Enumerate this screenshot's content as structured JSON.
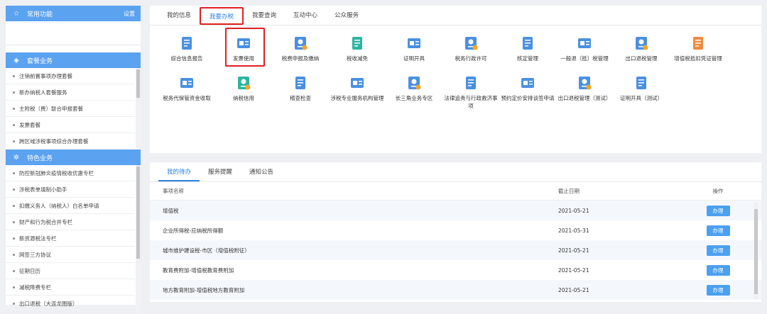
{
  "sidebar": {
    "common": {
      "title": "常用功能",
      "setting": "设置"
    },
    "package": {
      "title": "套餐业务",
      "items": [
        "注销前置事项办理套餐",
        "新办纳税人套餐服务",
        "主附税（费）联合申报套餐",
        "发票套餐",
        "跨区域涉税事项综合办理套餐"
      ]
    },
    "special": {
      "title": "特色业务",
      "items": [
        "防控新冠肺炎疫情税收优惠专栏",
        "涉税表单填制小助手",
        "扣缴义务人（纳税人）白名单申请",
        "财产和行为税合并专栏",
        "新资源税法专栏",
        "网签三方协议",
        "征期日历",
        "减税降费专栏",
        "出口退税（大连龙图版）"
      ]
    }
  },
  "top_tabs": [
    "我的信息",
    "我要办税",
    "我要查询",
    "互动中心",
    "公众服务"
  ],
  "services": [
    {
      "label": "综合信息报告",
      "icon": "report-icon",
      "color": "#4a90e2"
    },
    {
      "label": "发票使用",
      "icon": "invoice-icon",
      "color": "#4a90e2"
    },
    {
      "label": "税费申报及缴纳",
      "icon": "tax-declare-icon",
      "color": "#4a90e2"
    },
    {
      "label": "税收减免",
      "icon": "tax-relief-icon",
      "color": "#2cb5a0"
    },
    {
      "label": "证明开具",
      "icon": "certificate-icon",
      "color": "#4a90e2"
    },
    {
      "label": "税务行政许可",
      "icon": "permit-icon",
      "color": "#4a90e2"
    },
    {
      "label": "核定管理",
      "icon": "verify-icon",
      "color": "#4a90e2"
    },
    {
      "label": "一般退（抵）税管理",
      "icon": "refund-icon",
      "color": "#4a90e2"
    },
    {
      "label": "出口退税管理",
      "icon": "export-refund-icon",
      "color": "#4a90e2"
    },
    {
      "label": "增值税抵扣凭证管理",
      "icon": "vat-voucher-icon",
      "color": "#f08a3c"
    },
    {
      "label": "税务代保管资金收取",
      "icon": "custody-icon",
      "color": "#4a90e2"
    },
    {
      "label": "纳税信用",
      "icon": "credit-icon",
      "color": "#2cb5a0"
    },
    {
      "label": "稽查检查",
      "icon": "inspection-icon",
      "color": "#4a90e2"
    },
    {
      "label": "涉税专业服务机构管理",
      "icon": "agency-icon",
      "color": "#4a90e2"
    },
    {
      "label": "长三角业务专区",
      "icon": "yangtze-icon",
      "color": "#4a90e2"
    },
    {
      "label": "法律追责与行政救济事项",
      "icon": "law-icon",
      "color": "#4a90e2"
    },
    {
      "label": "预约定价安排谈签申请",
      "icon": "pricing-icon",
      "color": "#4a90e2"
    },
    {
      "label": "出口退税管理（测试）",
      "icon": "export-test-icon",
      "color": "#4a90e2"
    },
    {
      "label": "证明开具（测试）",
      "icon": "cert-test-icon",
      "color": "#4a90e2"
    }
  ],
  "bottom_tabs": [
    "我的待办",
    "服务提醒",
    "通知公告"
  ],
  "table": {
    "headers": [
      "事项名称",
      "截止日期",
      "操作"
    ],
    "rows": [
      {
        "name": "增值税",
        "date": "2021-05-21",
        "action": "办理"
      },
      {
        "name": "企业所得税-应纳税所得额",
        "date": "2021-05-31",
        "action": "办理"
      },
      {
        "name": "城市维护建设税-市区（增值税附征）",
        "date": "2021-05-21",
        "action": "办理"
      },
      {
        "name": "教育费附加-增值税教育费附加",
        "date": "2021-05-21",
        "action": "办理"
      },
      {
        "name": "地方教育附加-增值税地方教育附加",
        "date": "2021-05-21",
        "action": "办理"
      }
    ]
  }
}
